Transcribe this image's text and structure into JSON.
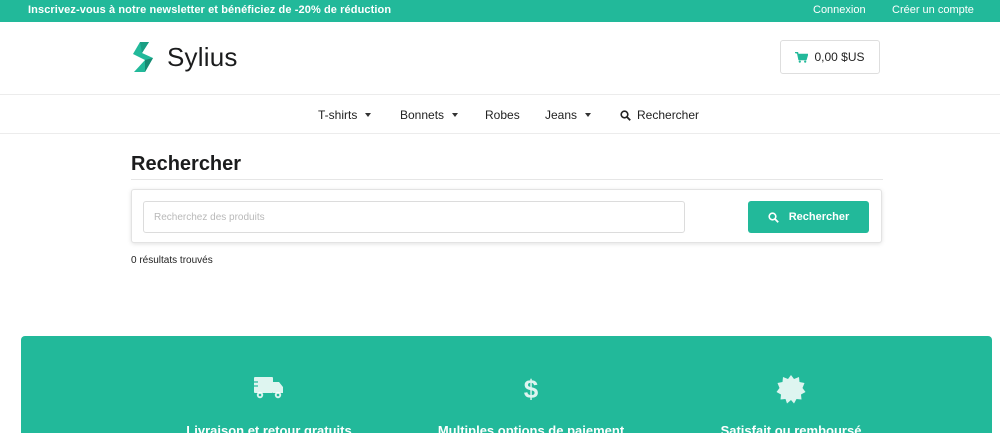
{
  "topbar": {
    "promo": "Inscrivez-vous à notre newsletter et bénéficiez de -20% de réduction",
    "login": "Connexion",
    "register": "Créer un compte"
  },
  "header": {
    "brand": "Sylius",
    "cart_total": "0,00 $US"
  },
  "nav": {
    "items": [
      {
        "label": "T-shirts"
      },
      {
        "label": "Bonnets"
      },
      {
        "label": "Robes"
      },
      {
        "label": "Jeans"
      },
      {
        "label": "Rechercher"
      }
    ]
  },
  "main": {
    "title": "Rechercher",
    "search": {
      "placeholder": "Recherchez des produits",
      "value": "",
      "button_label": "Rechercher"
    },
    "results_text": "0 résultats trouvés"
  },
  "footer": {
    "features": [
      {
        "icon": "truck-icon",
        "title": "Livraison et retour gratuits"
      },
      {
        "icon": "dollar-icon",
        "title": "Multiples options de paiement"
      },
      {
        "icon": "certificate-icon",
        "title": "Satisfait ou remboursé"
      }
    ]
  },
  "colors": {
    "accent": "#22b99a",
    "text": "#1b1c1d"
  }
}
